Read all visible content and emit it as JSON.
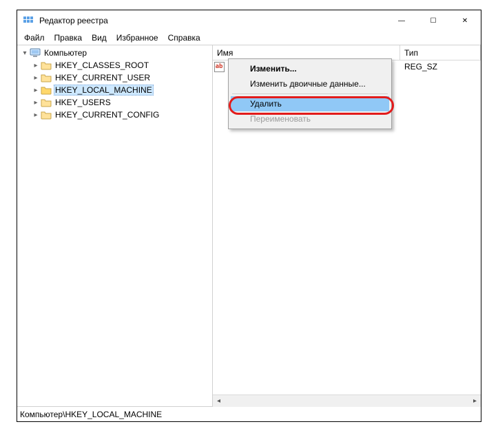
{
  "window": {
    "title": "Редактор реестра",
    "buttons": {
      "min": "—",
      "max": "☐",
      "close": "✕"
    }
  },
  "menubar": [
    "Файл",
    "Правка",
    "Вид",
    "Избранное",
    "Справка"
  ],
  "tree": {
    "root": "Компьютер",
    "keys": [
      "HKEY_CLASSES_ROOT",
      "HKEY_CURRENT_USER",
      "HKEY_LOCAL_MACHINE",
      "HKEY_USERS",
      "HKEY_CURRENT_CONFIG"
    ],
    "selected_index": 2
  },
  "list": {
    "columns": {
      "name": "Имя",
      "type": "Тип"
    },
    "rows": [
      {
        "icon": "ab",
        "name": "",
        "type": "REG_SZ"
      }
    ]
  },
  "context_menu": {
    "items": [
      {
        "label": "Изменить...",
        "bold": true,
        "enabled": true
      },
      {
        "label": "Изменить двоичные данные...",
        "enabled": true
      },
      {
        "sep": true
      },
      {
        "label": "Удалить",
        "enabled": true,
        "highlight": true
      },
      {
        "label": "Переименовать",
        "enabled": false
      }
    ]
  },
  "statusbar": "Компьютер\\HKEY_LOCAL_MACHINE"
}
